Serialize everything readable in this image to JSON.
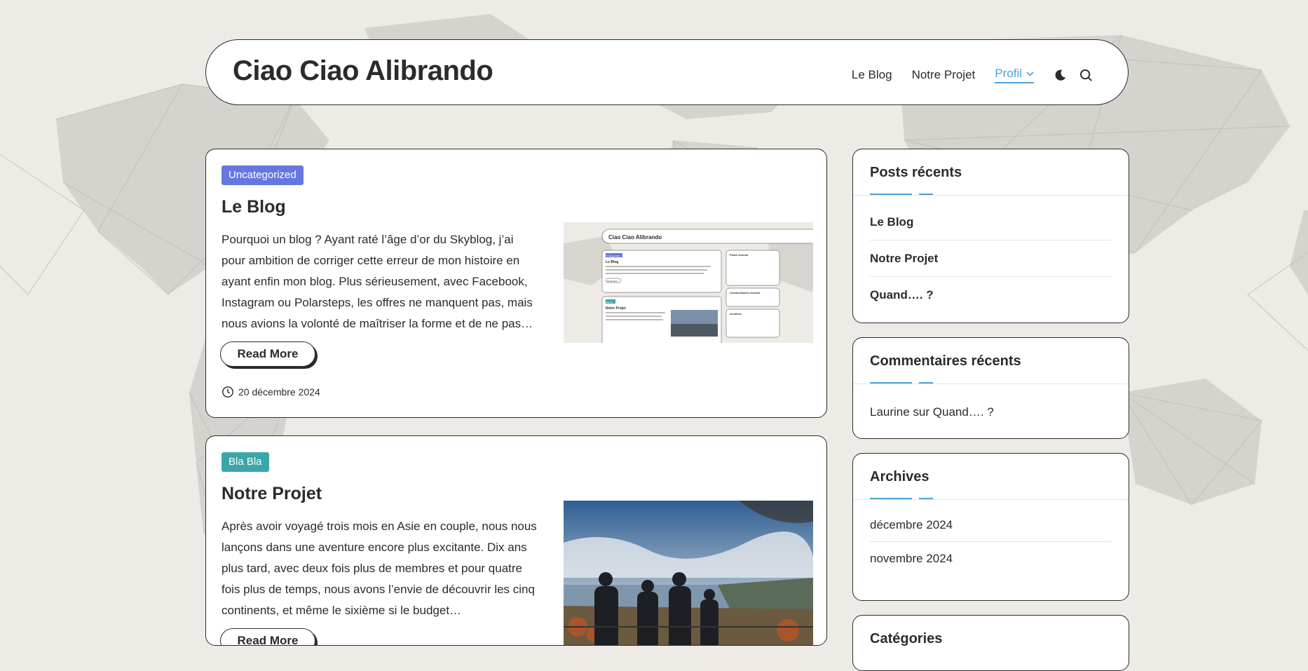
{
  "site": {
    "title": "Ciao Ciao Alibrando"
  },
  "nav": {
    "items": [
      "Le Blog",
      "Notre Projet"
    ],
    "active": "Profil",
    "theme_icon": "moon-icon",
    "search_icon": "search-icon"
  },
  "posts": [
    {
      "category": "Uncategorized",
      "category_color": "#6678e0",
      "title": "Le Blog",
      "excerpt": "Pourquoi un blog ? Ayant raté l’âge d’or du Skyblog, j’ai pour ambition de corriger cette erreur de mon histoire en ayant enfin mon blog. Plus sérieusement, avec Facebook, Instagram ou Polarsteps, les offres ne manquent pas, mais nous avions la volonté de maîtriser la forme et de ne pas…",
      "read_more": "Read More",
      "date": "20 décembre 2024",
      "thumb": {
        "title": "Ciao Ciao Alibrando",
        "tag1": "Uncategorized",
        "post1": "Le Blog",
        "tag2": "Bla Bla",
        "post2": "Notre Projet",
        "read_more": "Read More",
        "w1": "Posts récents",
        "w2": "Commentaires récents",
        "w3": "Archives"
      }
    },
    {
      "category": "Bla Bla",
      "category_color": "#3aa6a8",
      "title": "Notre Projet",
      "excerpt": "Après avoir voyagé trois mois en Asie en couple, nous nous lançons dans une aventure encore plus excitante. Dix ans plus tard, avec deux fois plus de membres et pour quatre fois plus de temps, nous avons l’envie de découvrir les cinq continents, et même le sixième si le budget…",
      "read_more": "Read More"
    }
  ],
  "sidebar": {
    "recent_posts": {
      "title": "Posts récents",
      "items": [
        "Le Blog",
        "Notre Projet",
        "Quand…. ?"
      ]
    },
    "recent_comments": {
      "title": "Commentaires récents",
      "item": "Laurine sur Quand…. ?"
    },
    "archives": {
      "title": "Archives",
      "items": [
        "décembre 2024",
        "novembre 2024"
      ]
    },
    "categories": {
      "title": "Catégories"
    }
  },
  "colors": {
    "accent": "#4aa3e0",
    "text": "#2b2b2b",
    "background": "#eeebe7"
  }
}
